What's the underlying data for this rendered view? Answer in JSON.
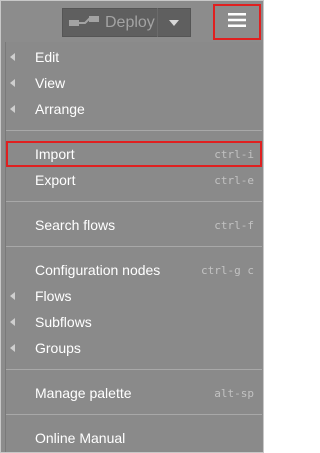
{
  "toolbar": {
    "deploy_label": "Deploy",
    "deploy_icon": "deploy-flow-icon",
    "dropdown_icon": "caret-down-icon",
    "menu_icon": "hamburger-menu-icon"
  },
  "menu": {
    "items": [
      {
        "label": "Edit",
        "submenu": true,
        "shortcut": ""
      },
      {
        "label": "View",
        "submenu": true,
        "shortcut": ""
      },
      {
        "label": "Arrange",
        "submenu": true,
        "shortcut": ""
      },
      {
        "label": "Import",
        "submenu": false,
        "shortcut": "ctrl-i"
      },
      {
        "label": "Export",
        "submenu": false,
        "shortcut": "ctrl-e"
      },
      {
        "label": "Search flows",
        "submenu": false,
        "shortcut": "ctrl-f"
      },
      {
        "label": "Configuration nodes",
        "submenu": false,
        "shortcut": "ctrl-g c"
      },
      {
        "label": "Flows",
        "submenu": true,
        "shortcut": ""
      },
      {
        "label": "Subflows",
        "submenu": true,
        "shortcut": ""
      },
      {
        "label": "Groups",
        "submenu": true,
        "shortcut": ""
      },
      {
        "label": "Manage palette",
        "submenu": false,
        "shortcut": "alt-sp"
      },
      {
        "label": "Online Manual",
        "submenu": false,
        "shortcut": ""
      }
    ]
  },
  "colors": {
    "highlight": "#e02020",
    "menu_bg": "#8a8a8a",
    "text": "#ffffff"
  }
}
